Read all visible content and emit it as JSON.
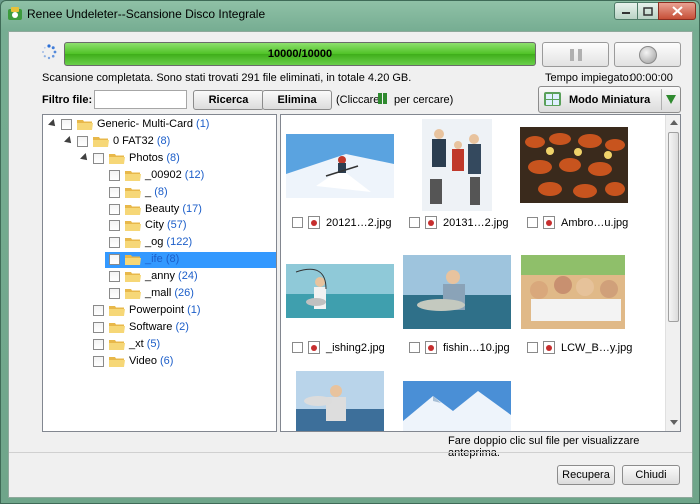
{
  "window": {
    "title": "Renee Undeleter--Scansione Disco Integrale",
    "minimize_icon": "minimize-icon",
    "maximize_icon": "maximize-icon",
    "close_icon": "close-icon"
  },
  "scan": {
    "progress_text": "10000/10000",
    "progress_fraction": 1.0,
    "status": "Scansione completata. Sono stati trovati 291 file eliminati, in totale 4.20 GB.",
    "time_label": "Tempo impiegato:",
    "time_value": "00:00:00",
    "pause_icon": "pause-icon",
    "stop_icon": "stop-icon",
    "colors": {
      "progress": "#4fc226",
      "accent": "#2f8a2f"
    }
  },
  "filter": {
    "label": "Filtro file:",
    "value": "",
    "search_label": "Ricerca",
    "delete_label": "Elimina",
    "hint_open": "(Cliccare",
    "hint_close": "per cercare)"
  },
  "view": {
    "label": "Modo Miniatura"
  },
  "tree": [
    {
      "name": "Generic- Multi-Card",
      "count": "(1)",
      "depth": 0,
      "expander": true,
      "selected": false
    },
    {
      "name": "0 FAT32",
      "count": "(8)",
      "depth": 1,
      "expander": true,
      "selected": false
    },
    {
      "name": "Photos",
      "count": "(8)",
      "depth": 2,
      "expander": true,
      "selected": false
    },
    {
      "name": "_00902",
      "count": "(12)",
      "depth": 3,
      "expander": false,
      "selected": false
    },
    {
      "name": "_",
      "count": "(8)",
      "depth": 3,
      "expander": false,
      "selected": false
    },
    {
      "name": "Beauty",
      "count": "(17)",
      "depth": 3,
      "expander": false,
      "selected": false
    },
    {
      "name": "City",
      "count": "(57)",
      "depth": 3,
      "expander": false,
      "selected": false
    },
    {
      "name": "_og",
      "count": "(122)",
      "depth": 3,
      "expander": false,
      "selected": false
    },
    {
      "name": "_ife",
      "count": "(8)",
      "depth": 3,
      "expander": false,
      "selected": true
    },
    {
      "name": "_anny",
      "count": "(24)",
      "depth": 3,
      "expander": false,
      "selected": false
    },
    {
      "name": "_mall",
      "count": "(26)",
      "depth": 3,
      "expander": false,
      "selected": false
    },
    {
      "name": "Powerpoint",
      "count": "(1)",
      "depth": 2,
      "expander": false,
      "selected": false
    },
    {
      "name": "Software",
      "count": "(2)",
      "depth": 2,
      "expander": false,
      "selected": false
    },
    {
      "name": "_xt",
      "count": "(5)",
      "depth": 2,
      "expander": false,
      "selected": false
    },
    {
      "name": "Video",
      "count": "(6)",
      "depth": 2,
      "expander": false,
      "selected": false
    }
  ],
  "thumbnails": [
    {
      "name": "20121…2.jpg",
      "scene": "ski"
    },
    {
      "name": "20131…2.jpg",
      "scene": "snowfamily"
    },
    {
      "name": "Ambro…u.jpg",
      "scene": "food"
    },
    {
      "name": "_ishing2.jpg",
      "scene": "fishing1"
    },
    {
      "name": "fishin…10.jpg",
      "scene": "fishing2"
    },
    {
      "name": "LCW_B…y.jpg",
      "scene": "party"
    },
    {
      "name": "",
      "scene": "fishing3"
    },
    {
      "name": "",
      "scene": "mountain"
    }
  ],
  "footer": {
    "hint": "Fare doppio clic sul file per visualizzare anteprima.",
    "recover_label": "Recupera",
    "close_label": "Chiudi"
  }
}
